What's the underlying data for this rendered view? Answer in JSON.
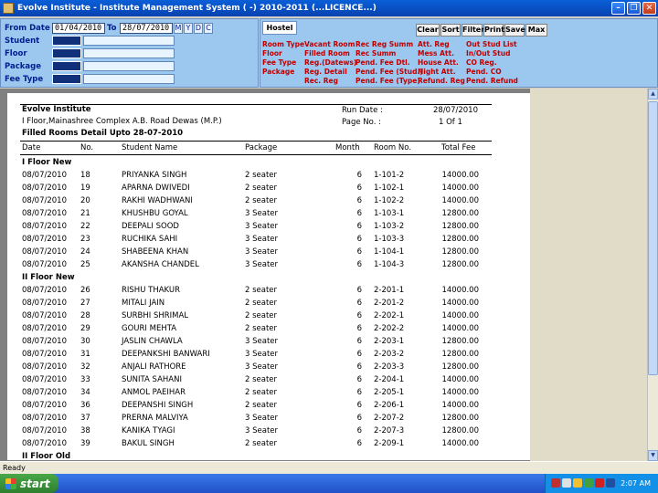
{
  "window": {
    "title": "Evolve Institute - Institute Management System ( -) 2010-2011 (...LICENCE...)"
  },
  "filters": {
    "from_date_label": "From Date",
    "from_date": "01/04/2010",
    "to_label": "To",
    "to_date": "28/07/2010",
    "period_buttons": [
      "M",
      "Y",
      "D",
      "C"
    ],
    "rows": [
      "Student",
      "Floor",
      "Package",
      "Fee Type"
    ]
  },
  "hostel": {
    "tab": "Hostel",
    "toolbar": [
      "Clear",
      "Sort",
      "Filter",
      "Print",
      "Save",
      "Max"
    ],
    "links": [
      [
        "Room Type",
        "Floor",
        "Fee Type",
        "Package"
      ],
      [
        "Vacant Room",
        "Filled Room",
        "Reg.(Datews)",
        "Reg. Detail",
        "Rec. Reg"
      ],
      [
        "Rec Reg Summ",
        "Rec Summ",
        "Pend. Fee Dtl.",
        "Pend. Fee (Stud.)",
        "Pend. Fee (Type)"
      ],
      [
        "Att. Reg",
        "Mess Att.",
        "House Att.",
        "Night Att.",
        "Refund. Reg"
      ],
      [
        "Out Stud List",
        "In/Out Stud",
        "CO Reg.",
        "Pend. CO",
        "Pend. Refund"
      ]
    ]
  },
  "report": {
    "institute": "Evolve Institute",
    "address": "I Floor,Mainashree Complex A.B. Road Dewas (M.P.)",
    "title": "Filled Rooms Detail Upto 28-07-2010",
    "run_date_label": "Run Date :",
    "run_date": "28/07/2010",
    "page_no_label": "Page No. :",
    "page_no": "1 Of 1",
    "columns": [
      "Date",
      "No.",
      "Student Name",
      "Package",
      "Month",
      "Room No.",
      "Total Fee"
    ],
    "groups": [
      {
        "name": "I Floor New",
        "rows": [
          [
            "08/07/2010",
            "18",
            "PRIYANKA  SINGH",
            "2 seater",
            "6",
            "1-101-2",
            "14000.00"
          ],
          [
            "08/07/2010",
            "19",
            "APARNA  DWIVEDI",
            "2 seater",
            "6",
            "1-102-1",
            "14000.00"
          ],
          [
            "08/07/2010",
            "20",
            "RAKHI WADHWANI",
            "2 seater",
            "6",
            "1-102-2",
            "14000.00"
          ],
          [
            "08/07/2010",
            "21",
            "KHUSHBU  GOYAL",
            "3 Seater",
            "6",
            "1-103-1",
            "12800.00"
          ],
          [
            "08/07/2010",
            "22",
            "DEEPALI  SOOD",
            "3 Seater",
            "6",
            "1-103-2",
            "12800.00"
          ],
          [
            "08/07/2010",
            "23",
            "RUCHIKA  SAHI",
            "3 Seater",
            "6",
            "1-103-3",
            "12800.00"
          ],
          [
            "08/07/2010",
            "24",
            "SHABEENA KHAN",
            "3 Seater",
            "6",
            "1-104-1",
            "12800.00"
          ],
          [
            "08/07/2010",
            "25",
            "AKANSHA CHANDEL",
            "3 Seater",
            "6",
            "1-104-3",
            "12800.00"
          ]
        ]
      },
      {
        "name": "II Floor New",
        "rows": [
          [
            "08/07/2010",
            "26",
            "RISHU  THAKUR",
            "2 seater",
            "6",
            "2-201-1",
            "14000.00"
          ],
          [
            "08/07/2010",
            "27",
            "MITALI  JAIN",
            "2 seater",
            "6",
            "2-201-2",
            "14000.00"
          ],
          [
            "08/07/2010",
            "28",
            "SURBHI  SHRIMAL",
            "2 seater",
            "6",
            "2-202-1",
            "14000.00"
          ],
          [
            "08/07/2010",
            "29",
            "GOURI  MEHTA",
            "2 seater",
            "6",
            "2-202-2",
            "14000.00"
          ],
          [
            "08/07/2010",
            "30",
            "JASLIN  CHAWLA",
            "3 Seater",
            "6",
            "2-203-1",
            "12800.00"
          ],
          [
            "08/07/2010",
            "31",
            "DEEPANKSHI  BANWARI",
            "3 Seater",
            "6",
            "2-203-2",
            "12800.00"
          ],
          [
            "08/07/2010",
            "32",
            "ANJALI  RATHORE",
            "3 Seater",
            "6",
            "2-203-3",
            "12800.00"
          ],
          [
            "08/07/2010",
            "33",
            "SUNITA  SAHANI",
            "2 seater",
            "6",
            "2-204-1",
            "14000.00"
          ],
          [
            "08/07/2010",
            "34",
            "ANMOL  PAEIHAR",
            "2 seater",
            "6",
            "2-205-1",
            "14000.00"
          ],
          [
            "08/07/2010",
            "36",
            "DEEPANSHI  SINGH",
            "2 seater",
            "6",
            "2-206-1",
            "14000.00"
          ],
          [
            "08/07/2010",
            "37",
            "PRERNA  MALVIYA",
            "3 Seater",
            "6",
            "2-207-2",
            "12800.00"
          ],
          [
            "08/07/2010",
            "38",
            "KANIKA  TYAGI",
            "3 Seater",
            "6",
            "2-207-3",
            "12800.00"
          ],
          [
            "08/07/2010",
            "39",
            "BAKUL  SINGH",
            "2 seater",
            "6",
            "2-209-1",
            "14000.00"
          ]
        ]
      },
      {
        "name": "II Floor Old",
        "rows": []
      }
    ]
  },
  "status": {
    "text": "Ready"
  },
  "taskbar": {
    "start_label": "start",
    "clock": "2:07 AM"
  }
}
